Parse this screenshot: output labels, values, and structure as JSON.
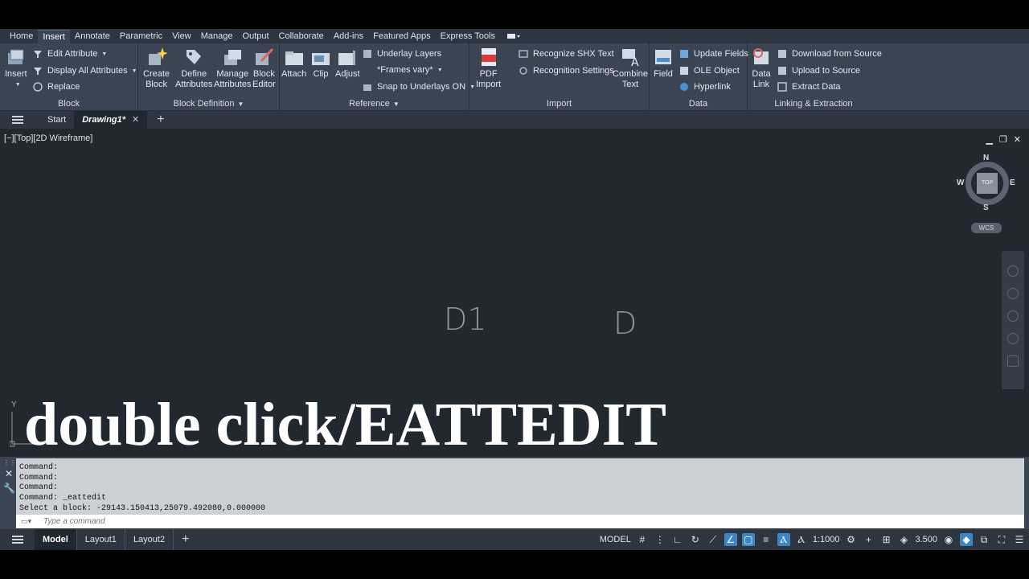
{
  "menu": {
    "tabs": [
      "Home",
      "Insert",
      "Annotate",
      "Parametric",
      "View",
      "Manage",
      "Output",
      "Collaborate",
      "Add-ins",
      "Featured Apps",
      "Express Tools"
    ],
    "active": "Insert"
  },
  "ribbon": {
    "block": {
      "title": "Block",
      "insert": "Insert",
      "edit_attribute": "Edit Attribute",
      "display_all_attributes": "Display All Attributes",
      "replace": "Replace"
    },
    "block_definition": {
      "title": "Block Definition",
      "create_block_1": "Create",
      "create_block_2": "Block",
      "define_attributes_1": "Define",
      "define_attributes_2": "Attributes",
      "manage_attributes_1": "Manage",
      "manage_attributes_2": "Attributes",
      "block_editor_1": "Block",
      "block_editor_2": "Editor"
    },
    "reference": {
      "title": "Reference",
      "attach": "Attach",
      "clip": "Clip",
      "adjust": "Adjust",
      "underlay_layers": "Underlay Layers",
      "frames_vary": "*Frames vary*",
      "snap_to_underlays": "Snap to Underlays ON"
    },
    "import": {
      "title": "Import",
      "pdf_import_1": "PDF",
      "pdf_import_2": "Import",
      "recognize_shx": "Recognize SHX Text",
      "recognition_settings": "Recognition Settings",
      "combine_text_1": "Combine",
      "combine_text_2": "Text"
    },
    "data": {
      "title": "Data",
      "field": "Field",
      "update_fields": "Update Fields",
      "ole_object": "OLE Object",
      "hyperlink": "Hyperlink"
    },
    "linking": {
      "title": "Linking & Extraction",
      "data_link_1": "Data",
      "data_link_2": "Link",
      "download_from_source": "Download from Source",
      "upload_to_source": "Upload to Source",
      "extract_data": "Extract  Data"
    }
  },
  "doc_tabs": {
    "start": "Start",
    "drawing": "Drawing1*"
  },
  "viewport": {
    "label": "[−][Top][2D Wireframe]",
    "cube_top": "TOP",
    "compass": {
      "n": "N",
      "s": "S",
      "e": "E",
      "w": "W"
    },
    "wcs": "WCS",
    "text_d1": "D1",
    "text_d": "D",
    "ucs_y": "Y",
    "overlay_caption": "double click/EATTEDIT"
  },
  "command": {
    "history": [
      "Command:",
      "Command:",
      "Command:",
      "Command: _eattedit",
      "Select a block: -29143.150413,25079.492080,0.000000"
    ],
    "placeholder": "Type a command"
  },
  "status": {
    "layouts": [
      "Model",
      "Layout1",
      "Layout2"
    ],
    "model_label": "MODEL",
    "scale": "1:1000",
    "lineweight": "3.500"
  },
  "colors": {
    "ribbon_bg": "#3b4453",
    "viewport_bg": "#212830",
    "accent": "#3d86c6"
  }
}
